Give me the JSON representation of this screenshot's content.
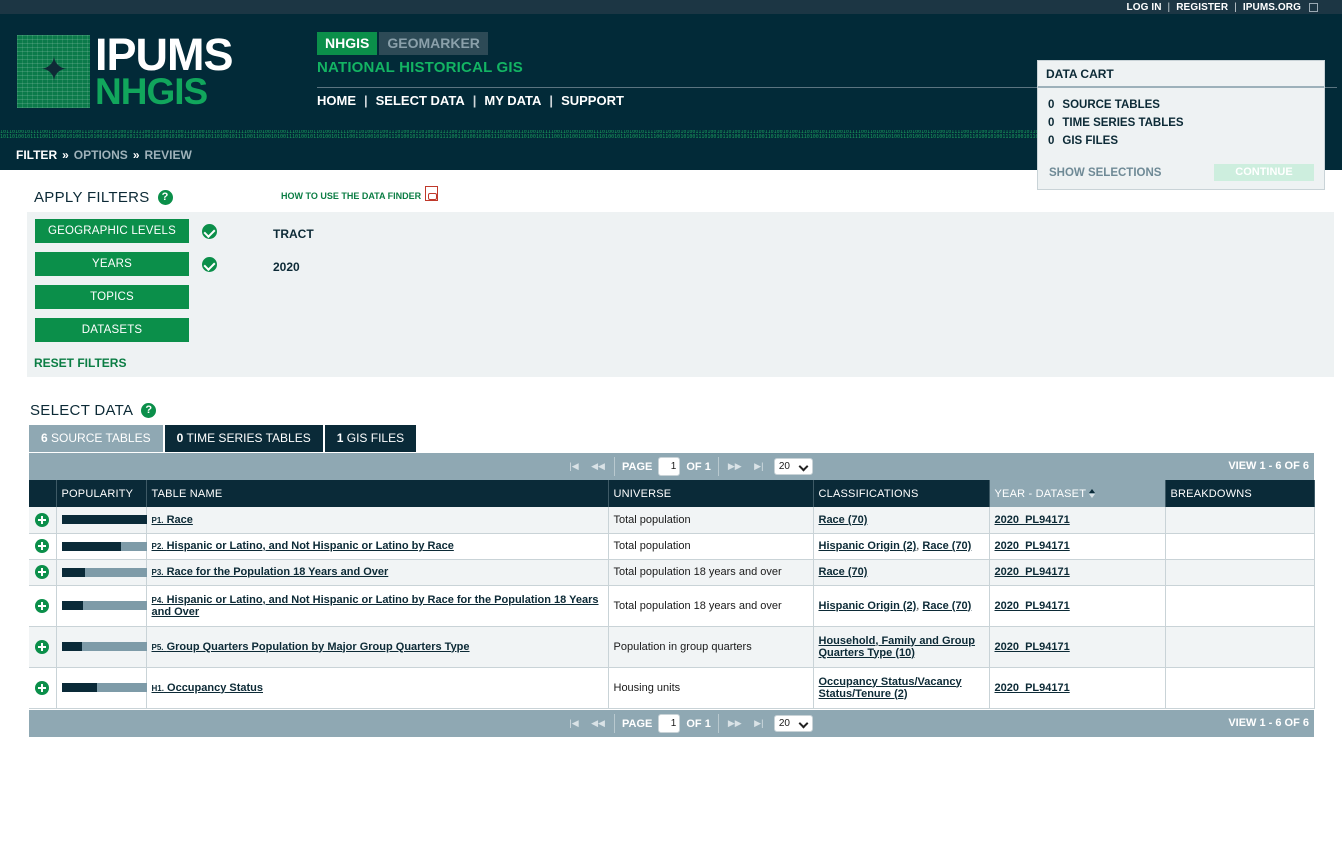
{
  "top_links": [
    "LOG IN",
    "REGISTER",
    "IPUMS.ORG"
  ],
  "logo": {
    "line1": "IPUMS",
    "line2": "NHGIS"
  },
  "product_tabs": [
    {
      "label": "NHGIS",
      "active": true
    },
    {
      "label": "GEOMARKER",
      "active": false
    }
  ],
  "subtitle": "NATIONAL HISTORICAL GIS",
  "main_nav": [
    "HOME",
    "SELECT DATA",
    "MY DATA",
    "SUPPORT"
  ],
  "binary_strip": "10110100101111001101001010011101001011010010111100110100101001110100101101001011110011010010100111010010110100101111001101001010011101001011010010111100110100101001110100101101001011110011010010100111010010110100101111001101001010011101001011010010111100110100101001110100101101001011110011010010100111010010110100101111001101001010011101001011010010111100110100101001110100101101001011110011010010100111010010",
  "breadcrumb": {
    "current": "FILTER",
    "steps": [
      "OPTIONS",
      "REVIEW"
    ],
    "separator": "»"
  },
  "data_cart": {
    "title": "DATA CART",
    "rows": [
      {
        "count": "0",
        "label": "SOURCE TABLES"
      },
      {
        "count": "0",
        "label": "TIME SERIES TABLES"
      },
      {
        "count": "0",
        "label": "GIS FILES"
      }
    ],
    "show_selections": "SHOW SELECTIONS",
    "continue": "CONTINUE"
  },
  "apply_filters": {
    "title": "APPLY FILTERS",
    "help": "?",
    "howto": "HOW TO USE THE DATA FINDER",
    "filters": [
      {
        "label": "GEOGRAPHIC LEVELS",
        "checked": true,
        "value": "TRACT"
      },
      {
        "label": "YEARS",
        "checked": true,
        "value": "2020"
      },
      {
        "label": "TOPICS",
        "checked": false,
        "value": ""
      },
      {
        "label": "DATASETS",
        "checked": false,
        "value": ""
      }
    ],
    "reset": "RESET FILTERS"
  },
  "select_data": {
    "title": "SELECT DATA",
    "help": "?",
    "tabs": [
      {
        "count": "6",
        "label": "SOURCE TABLES",
        "active": true
      },
      {
        "count": "0",
        "label": "TIME SERIES TABLES",
        "active": false
      },
      {
        "count": "1",
        "label": "GIS FILES",
        "active": false
      }
    ]
  },
  "pager": {
    "page_label": "PAGE",
    "page_value": "1",
    "of_label": "OF 1",
    "per_page": "20",
    "view_text": "VIEW 1 - 6 OF 6",
    "icons": {
      "first": "|◀",
      "prev": "◀◀",
      "next": "▶▶",
      "last": "▶|"
    }
  },
  "table": {
    "headers": {
      "add": "",
      "popularity": "POPULARITY",
      "name": "TABLE NAME",
      "universe": "UNIVERSE",
      "classifications": "CLASSIFICATIONS",
      "year_dataset": "YEAR - DATASET",
      "breakdowns": "BREAKDOWNS"
    },
    "rows": [
      {
        "code": "P1.",
        "name": "Race",
        "popularity": 1.0,
        "universe": "Total population",
        "classifications": [
          "Race (70)"
        ],
        "dataset": "2020_PL94171",
        "breakdowns": ""
      },
      {
        "code": "P2.",
        "name": "Hispanic or Latino, and Not Hispanic or Latino by Race",
        "popularity": 0.7,
        "universe": "Total population",
        "classifications": [
          "Hispanic Origin (2)",
          "Race (70)"
        ],
        "dataset": "2020_PL94171",
        "breakdowns": ""
      },
      {
        "code": "P3.",
        "name": "Race for the Population 18 Years and Over",
        "popularity": 0.27,
        "universe": "Total population 18 years and over",
        "classifications": [
          "Race (70)"
        ],
        "dataset": "2020_PL94171",
        "breakdowns": ""
      },
      {
        "code": "P4.",
        "name": "Hispanic or Latino, and Not Hispanic or Latino by Race for the Population 18 Years and Over",
        "popularity": 0.25,
        "universe": "Total population 18 years and over",
        "classifications": [
          "Hispanic Origin (2)",
          "Race (70)"
        ],
        "dataset": "2020_PL94171",
        "breakdowns": ""
      },
      {
        "code": "P5.",
        "name": "Group Quarters Population by Major Group Quarters Type",
        "popularity": 0.23,
        "universe": "Population in group quarters",
        "classifications": [
          "Household, Family and Group Quarters Type (10)"
        ],
        "dataset": "2020_PL94171",
        "breakdowns": ""
      },
      {
        "code": "H1.",
        "name": "Occupancy Status",
        "popularity": 0.41,
        "universe": "Housing units",
        "classifications": [
          "Occupancy Status/Vacancy Status/Tenure (2)"
        ],
        "dataset": "2020_PL94171",
        "breakdowns": ""
      }
    ]
  },
  "colors": {
    "header_bg": "#022a38",
    "accent_green": "#0b8f4a",
    "pager_bg": "#8fa8b3",
    "table_header_bg": "#0a2a38"
  }
}
